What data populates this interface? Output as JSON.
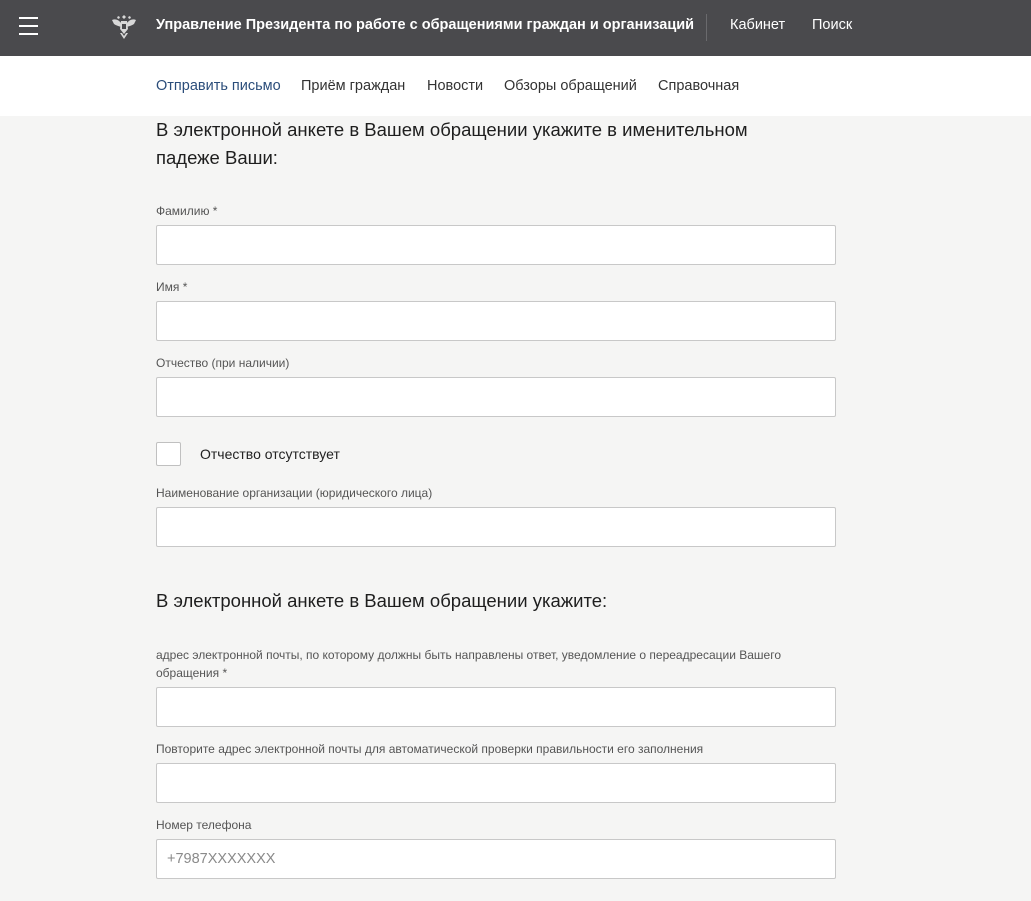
{
  "header": {
    "title": "Управление Президента по работе с обращениями граждан и организаций",
    "links": [
      "Кабинет",
      "Поиск"
    ],
    "menu_icon": "hamburger-icon",
    "emblem_icon": "double-headed-eagle-emblem"
  },
  "subnav": {
    "items": [
      "Отправить письмо",
      "Приём граждан",
      "Новости",
      "Обзоры обращений",
      "Справочная"
    ],
    "active_index": 0,
    "active_color": "#2b4d7a"
  },
  "form": {
    "section1_heading": "В электронной анкете в Вашем обращении укажите в именительном падеже Ваши:",
    "surname_label": "Фамилию *",
    "surname_value": "",
    "name_label": "Имя *",
    "name_value": "",
    "patronymic_label": "Отчество (при наличии)",
    "patronymic_value": "",
    "no_patronymic_label": "Отчество отсутствует",
    "no_patronymic_checked": false,
    "organization_label": "Наименование организации (юридического лица)",
    "organization_value": "",
    "section2_heading": "В электронной анкете в Вашем обращении укажите:",
    "email_label": "адрес электронной почты, по которому должны быть направлены ответ, уведомление о переадресации Вашего обращения *",
    "email_value": "",
    "email_repeat_label": "Повторите адрес электронной почты для автоматической проверки правильности его заполнения",
    "email_repeat_value": "",
    "phone_label": "Номер телефона",
    "phone_value": "",
    "phone_placeholder": "+7987XXXXXXX"
  },
  "colors": {
    "header_bg": "#4a4a4d",
    "page_bg": "#f5f5f4"
  }
}
